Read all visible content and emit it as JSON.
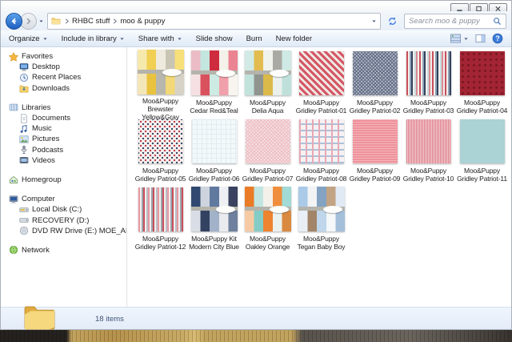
{
  "window": {
    "buttons": [
      {
        "name": "minimize",
        "icon": "minimize-icon"
      },
      {
        "name": "maximize",
        "icon": "maximize-icon"
      },
      {
        "name": "close",
        "icon": "close-icon"
      }
    ]
  },
  "address_bar": {
    "breadcrumb_segments": [
      "RHBC stuff",
      "moo & puppy"
    ],
    "search_placeholder": "Search moo & puppy",
    "icons": [
      "back-icon",
      "forward-icon",
      "folder-icon",
      "address-dropdown-icon",
      "refresh-icon",
      "search-icon"
    ]
  },
  "toolbar": {
    "items": [
      {
        "label": "Organize",
        "has_menu": true
      },
      {
        "label": "Include in library",
        "has_menu": true
      },
      {
        "label": "Share with",
        "has_menu": true
      },
      {
        "label": "Slide show",
        "has_menu": false
      },
      {
        "label": "Burn",
        "has_menu": false
      },
      {
        "label": "New folder",
        "has_menu": false
      }
    ],
    "right_icons": [
      "views-icon",
      "preview-pane-icon",
      "help-icon"
    ]
  },
  "sidebar": {
    "items": [
      {
        "label": "Favorites",
        "icon": "favorites-star-icon",
        "level": 0,
        "gap_before": false
      },
      {
        "label": "Desktop",
        "icon": "desktop-icon",
        "level": 1,
        "gap_before": false
      },
      {
        "label": "Recent Places",
        "icon": "recent-places-icon",
        "level": 1,
        "gap_before": false
      },
      {
        "label": "Downloads",
        "icon": "downloads-icon",
        "level": 1,
        "gap_before": false
      },
      {
        "label": "Libraries",
        "icon": "libraries-icon",
        "level": 0,
        "gap_before": true
      },
      {
        "label": "Documents",
        "icon": "documents-icon",
        "level": 1,
        "gap_before": false
      },
      {
        "label": "Music",
        "icon": "music-icon",
        "level": 1,
        "gap_before": false
      },
      {
        "label": "Pictures",
        "icon": "pictures-icon",
        "level": 1,
        "gap_before": false
      },
      {
        "label": "Podcasts",
        "icon": "podcasts-icon",
        "level": 1,
        "gap_before": false
      },
      {
        "label": "Videos",
        "icon": "videos-icon",
        "level": 1,
        "gap_before": false
      },
      {
        "label": "Homegroup",
        "icon": "homegroup-icon",
        "level": 0,
        "gap_before": true
      },
      {
        "label": "Computer",
        "icon": "computer-icon",
        "level": 0,
        "gap_before": true
      },
      {
        "label": "Local Disk (C:)",
        "icon": "local-disk-icon",
        "level": 1,
        "gap_before": false
      },
      {
        "label": "RECOVERY (D:)",
        "icon": "recovery-drive-icon",
        "level": 1,
        "gap_before": false
      },
      {
        "label": "DVD RW Drive (E:) MOE_AND_THE_BIG_E",
        "icon": "dvd-drive-icon",
        "level": 1,
        "gap_before": false
      },
      {
        "label": "Network",
        "icon": "network-icon",
        "level": 0,
        "gap_before": true
      }
    ]
  },
  "files": [
    {
      "caption_lines": [
        "Moo&Puppy",
        "Brewster",
        "Yellow&Gray"
      ],
      "kind": "collage",
      "top": [
        "#f6e9ac",
        "#f0cf52",
        "#efeade",
        "#c9c5b4",
        "#f7df7a"
      ],
      "bottom": [
        "#f3e6b8",
        "#e9c23e",
        "#b7b7ae",
        "#f2d876",
        "#d6d3c6"
      ],
      "band": "#b4b4ac"
    },
    {
      "caption_lines": [
        "Moo&Puppy",
        "Cedar Red&Teal"
      ],
      "kind": "collage",
      "top": [
        "#ecbcc6",
        "#c3e6df",
        "#ce2b3e",
        "#f4f1ea",
        "#ea8492"
      ],
      "bottom": [
        "#f6e0e3",
        "#da515e",
        "#cdeae3",
        "#f0a0aa",
        "#f8f4ef"
      ],
      "band": "#b4b4ac"
    },
    {
      "caption_lines": [
        "Moo&Puppy",
        "Delia Aqua"
      ],
      "kind": "collage",
      "top": [
        "#d2eae5",
        "#e2bc4e",
        "#f0f2ec",
        "#aaaaa4",
        "#cfe9e4"
      ],
      "bottom": [
        "#c2e2dc",
        "#90948f",
        "#dcba4a",
        "#eaf0ec",
        "#bfe0da"
      ],
      "band": "#b4b4ac"
    },
    {
      "caption_lines": [
        "Moo&Puppy",
        "Gridley Patriot-01"
      ],
      "kind": "diagonal",
      "colors": [
        "#d45866",
        "#f0eae6"
      ]
    },
    {
      "caption_lines": [
        "Moo&Puppy",
        "Gridley Patriot-02"
      ],
      "kind": "herringbone",
      "colors": [
        "#b6bdc9",
        "#5e6882"
      ]
    },
    {
      "caption_lines": [
        "Moo&Puppy",
        "Gridley Patriot-03"
      ],
      "kind": "vstripes",
      "colors": [
        "#c94f5c",
        "#f2efec",
        "#8fa3b5",
        "#32425e",
        "#f2efec",
        "#c9dedd",
        "#d98a94",
        "#f2efec"
      ]
    },
    {
      "caption_lines": [
        "Moo&Puppy",
        "Gridley Patriot-04"
      ],
      "kind": "dots",
      "colors": [
        "#a32433",
        "#6f1620"
      ]
    },
    {
      "caption_lines": [
        "Moo&Puppy",
        "Gridley Patriot-05"
      ],
      "kind": "ditsy",
      "colors": [
        "#f6f3f0",
        "#c03a4b",
        "#32425e"
      ]
    },
    {
      "caption_lines": [
        "Moo&Puppy",
        "Gridley Patriot-06"
      ],
      "kind": "grid",
      "colors": [
        "#f3f8fa",
        "#e1edf2"
      ]
    },
    {
      "caption_lines": [
        "Moo&Puppy",
        "Gridley Patriot-07"
      ],
      "kind": "crosshatch",
      "colors": [
        "#f7e3e6",
        "#ecbcc3"
      ]
    },
    {
      "caption_lines": [
        "Moo&Puppy",
        "Gridley Patriot-08"
      ],
      "kind": "plaid",
      "colors": [
        "#f7f1f2",
        "#e8a8b5",
        "#a9c2da"
      ]
    },
    {
      "caption_lines": [
        "Moo&Puppy",
        "Gridley Patriot-09"
      ],
      "kind": "texture",
      "colors": [
        "#ee929c",
        "#f6b4ba"
      ]
    },
    {
      "caption_lines": [
        "Moo&Puppy",
        "Gridley Patriot-10"
      ],
      "kind": "finestripe",
      "colors": [
        "#f3cdd1",
        "#de818c"
      ]
    },
    {
      "caption_lines": [
        "Moo&Puppy",
        "Gridley Patriot-11"
      ],
      "kind": "plain",
      "colors": [
        "#abd2d5"
      ]
    },
    {
      "caption_lines": [
        "Moo&Puppy",
        "Gridley Patriot-12"
      ],
      "kind": "vstripes",
      "colors": [
        "#e898a2",
        "#f3f0ee",
        "#9aa4ae",
        "#c94f5c",
        "#f3f0ee",
        "#b9bfc6"
      ]
    },
    {
      "caption_lines": [
        "Moo&Puppy Kit",
        "Modern City Blue"
      ],
      "kind": "collage",
      "top": [
        "#314970",
        "#cdd4de",
        "#60799f",
        "#eef0f4",
        "#3b4360"
      ],
      "bottom": [
        "#d9dee6",
        "#334260",
        "#a2b2c9",
        "#e9ebef",
        "#6e809d"
      ],
      "band": "#b4b4ac"
    },
    {
      "caption_lines": [
        "Moo&Puppy",
        "Oakley Orange"
      ],
      "kind": "collage",
      "top": [
        "#ea7c28",
        "#c2e5e2",
        "#f4f1e9",
        "#ef8f3e",
        "#a2dad6"
      ],
      "bottom": [
        "#f6cba4",
        "#84ccc6",
        "#ee8330",
        "#eaf1ef",
        "#d98a40"
      ],
      "band": "#b4b4ac"
    },
    {
      "caption_lines": [
        "Moo&Puppy",
        "Tegan Baby Boy"
      ],
      "kind": "collage",
      "top": [
        "#aacae8",
        "#f1f3f5",
        "#84a2c2",
        "#c2a384",
        "#dfeaf4"
      ],
      "bottom": [
        "#e9eff5",
        "#a28469",
        "#bfd6eb",
        "#f5f7f9",
        "#a4bfda"
      ],
      "band": "#b4b4ac"
    }
  ],
  "status_bar": {
    "items_count": "18 items",
    "icon": "folder-icon"
  }
}
